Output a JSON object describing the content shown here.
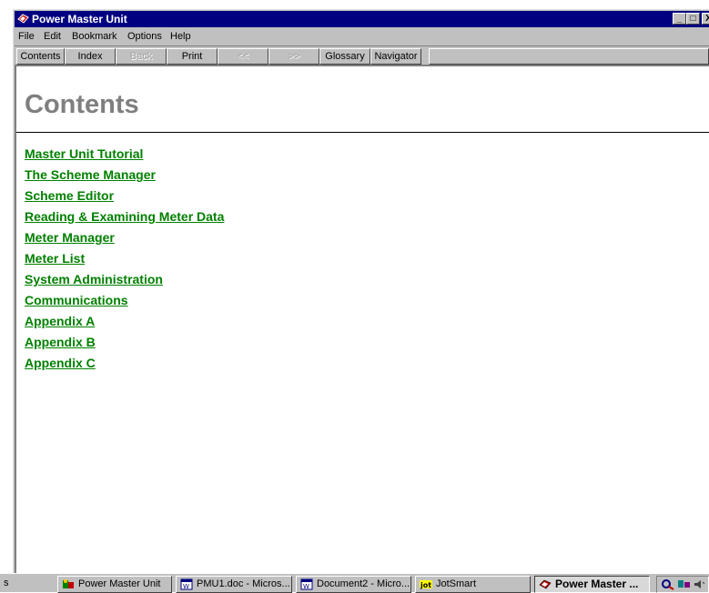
{
  "window": {
    "title": "Power Master Unit",
    "controls": {
      "minimize": "_",
      "maximize": "□",
      "close": "X"
    }
  },
  "menu": [
    "File",
    "Edit",
    "Bookmark",
    "Options",
    "Help"
  ],
  "toolbar": {
    "contents": "Contents",
    "index": "Index",
    "back": "Back",
    "print": "Print",
    "prev": "<<",
    "next": ">>",
    "glossary": "Glossary",
    "navigator": "Navigator"
  },
  "page": {
    "heading": "Contents",
    "links": [
      "Master Unit Tutorial",
      "The Scheme Manager",
      "Scheme Editor",
      "Reading & Examining Meter Data",
      "Meter Manager",
      "Meter List",
      "System Administration",
      "Communications",
      "Appendix A",
      "Appendix B",
      "Appendix C"
    ]
  },
  "taskbar": {
    "start_fragment": "s",
    "tasks": [
      {
        "label": "Power Master Unit",
        "icon": "app-icon"
      },
      {
        "label": "PMU1.doc - Micros...",
        "icon": "word-doc-icon"
      },
      {
        "label": "Document2 - Micro...",
        "icon": "word-doc-icon"
      },
      {
        "label": "JotSmart",
        "icon": "jot-icon"
      },
      {
        "label": "Power Master ...",
        "icon": "help-book-icon"
      }
    ]
  },
  "colors": {
    "titlebar": "#000080",
    "link": "#008000",
    "heading": "#7f7f7f",
    "chrome": "#c0c0c0"
  }
}
